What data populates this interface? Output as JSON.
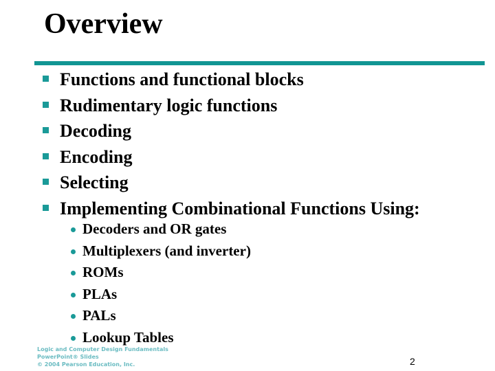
{
  "slide": {
    "title": "Overview",
    "accent_color": "#119593",
    "bullets": [
      "Functions and functional blocks",
      "Rudimentary logic functions",
      "Decoding",
      "Encoding",
      "Selecting",
      "Implementing Combinational Functions Using:"
    ],
    "sub_bullets": [
      "Decoders and OR gates",
      "Multiplexers (and inverter)",
      "ROMs",
      "PLAs",
      "PALs",
      "Lookup Tables"
    ],
    "footer": {
      "line1": "Logic and Computer Design Fundamentals",
      "line2": "PowerPoint® Slides",
      "line3": "© 2004 Pearson Education, Inc."
    },
    "page_number": "2"
  }
}
